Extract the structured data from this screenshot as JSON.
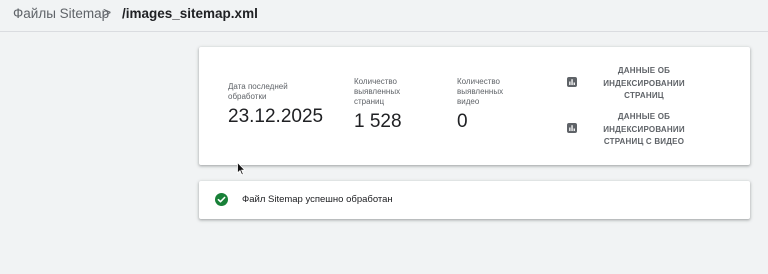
{
  "breadcrumb": {
    "root": "Файлы Sitemap",
    "separator": ">",
    "current": "/images_sitemap.xml"
  },
  "stats": [
    {
      "label": "Дата последней обработки",
      "value": "23.12.2025"
    },
    {
      "label": "Количество выявленных страниц",
      "value": "1 528"
    },
    {
      "label": "Количество выявленных видео",
      "value": "0"
    }
  ],
  "links": [
    {
      "label": "ДАННЫЕ ОБ ИНДЕКСИРОВАНИИ СТРАНИЦ",
      "icon": "bar-chart-icon"
    },
    {
      "label": "ДАННЫЕ ОБ ИНДЕКСИРОВАНИИ СТРАНИЦ С ВИДЕО",
      "icon": "bar-chart-icon"
    }
  ],
  "status": {
    "text": "Файл Sitemap успешно обработан",
    "icon": "check-circle-icon",
    "color": "#188038"
  }
}
